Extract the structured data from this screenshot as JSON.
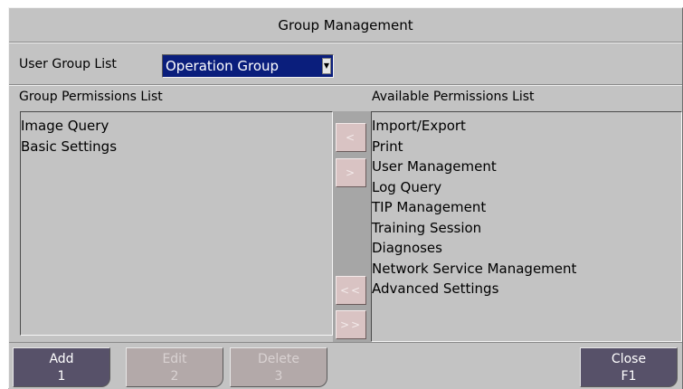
{
  "window": {
    "title": "Group Management"
  },
  "group": {
    "label": "User Group List",
    "selected": "Operation Group",
    "arrow_icon": "dropdown-arrow-icon"
  },
  "group_permissions": {
    "label": "Group Permissions List",
    "items": [
      "Image Query",
      "Basic Settings"
    ]
  },
  "available_permissions": {
    "label": "Available Permissions List",
    "items": [
      "Import/Export",
      "Print",
      "User Management",
      "Log Query",
      "TIP Management",
      "Training Session",
      "Diagnoses",
      "Network Service Management",
      "Advanced Settings"
    ]
  },
  "move": {
    "add_one": "<",
    "remove_one": ">",
    "add_all": "<<",
    "remove_all": ">>"
  },
  "buttons": {
    "add": {
      "label": "Add",
      "key": "1"
    },
    "edit": {
      "label": "Edit",
      "key": "2"
    },
    "delete": {
      "label": "Delete",
      "key": "3"
    },
    "close": {
      "label": "Close",
      "key": "F1"
    }
  },
  "colors": {
    "background": "#c3c3c3",
    "select_bg": "#0a1e7c",
    "active_button": "#575169",
    "disabled_button": "#b3a9a9",
    "move_button": "#d9c3c3"
  }
}
